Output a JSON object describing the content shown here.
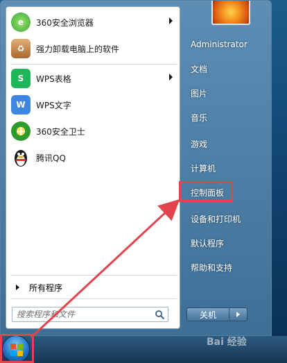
{
  "programs": [
    {
      "label": "360安全浏览器",
      "icon": "browser-icon",
      "color": "#3aa63a",
      "has_arrow": true
    },
    {
      "label": "强力卸载电脑上的软件",
      "icon": "uninstall-icon",
      "color": "#b8793a",
      "has_arrow": false
    },
    {
      "label": "WPS表格",
      "icon": "wps-spreadsheet-icon",
      "color": "#1fb559",
      "has_arrow": true
    },
    {
      "label": "WPS文字",
      "icon": "wps-writer-icon",
      "color": "#3f86e0",
      "has_arrow": false
    },
    {
      "label": "360安全卫士",
      "icon": "security-guard-icon",
      "color": "#2f9b2f",
      "has_arrow": false
    },
    {
      "label": "腾讯QQ",
      "icon": "qq-penguin-icon",
      "color": "#1a1a1a",
      "has_arrow": false
    }
  ],
  "all_programs_label": "所有程序",
  "search": {
    "placeholder": "搜索程序和文件"
  },
  "right_items": [
    {
      "label": "Administrator"
    },
    {
      "label": "文档"
    },
    {
      "label": "图片"
    },
    {
      "label": "音乐"
    },
    {
      "label": "游戏"
    },
    {
      "label": "计算机"
    },
    {
      "label": "控制面板"
    },
    {
      "label": "设备和打印机"
    },
    {
      "label": "默认程序"
    },
    {
      "label": "帮助和支持"
    }
  ],
  "shutdown_label": "关机",
  "watermark": "Bai 经验",
  "annotation_color": "#e2434d"
}
